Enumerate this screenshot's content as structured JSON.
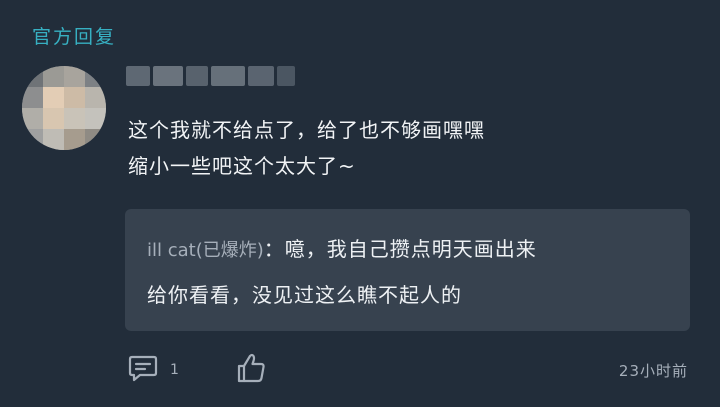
{
  "section": {
    "title": "官方回复"
  },
  "comment": {
    "lines": [
      "这个我就不给点了，给了也不够画嘿嘿",
      "缩小一些吧这个太大了~"
    ],
    "quote": {
      "author": "ill cat(已爆炸)",
      "separator": "：",
      "line1": "噫，我自己攒点明天画出来",
      "line2": "给你看看，没见过这么瞧不起人的"
    }
  },
  "footer": {
    "reply_count": "1",
    "timestamp": "23小时前",
    "reply_icon": "comment-icon",
    "like_icon": "thumbs-up-icon"
  },
  "colors": {
    "background": "#222d3a",
    "accent": "#37b0c2",
    "quote_background": "#37424f",
    "muted_text": "#a6afba"
  }
}
